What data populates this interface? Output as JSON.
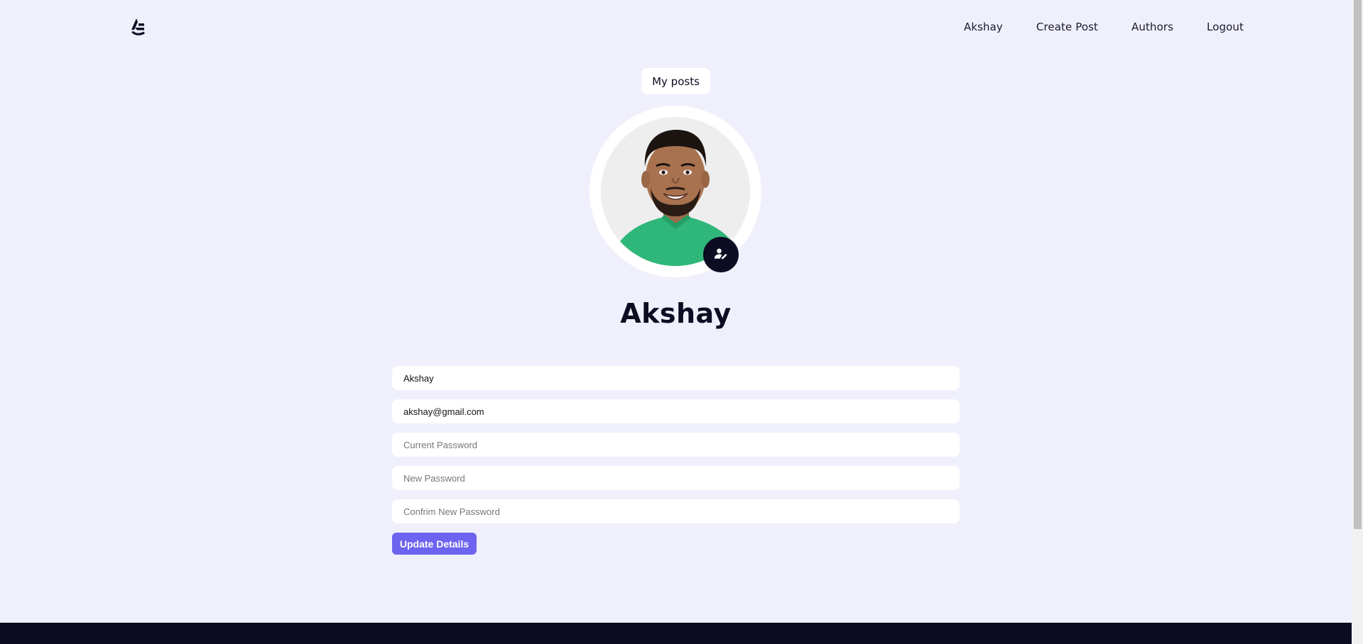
{
  "navbar": {
    "logo_icon": "logo-icon",
    "links": [
      {
        "label": "Akshay"
      },
      {
        "label": "Create Post"
      },
      {
        "label": "Authors"
      },
      {
        "label": "Logout"
      }
    ]
  },
  "profile": {
    "my_posts_label": "My posts",
    "edit_avatar_icon": "user-edit-icon",
    "name": "Akshay"
  },
  "form": {
    "name_value": "Akshay",
    "email_value": "akshay@gmail.com",
    "current_password_placeholder": "Current Password",
    "new_password_placeholder": "New Password",
    "confirm_password_placeholder": "Confrim New Password",
    "submit_label": "Update Details"
  },
  "colors": {
    "background": "#f0f0fd",
    "dark": "#0c0c22",
    "accent": "#6c63f0"
  }
}
